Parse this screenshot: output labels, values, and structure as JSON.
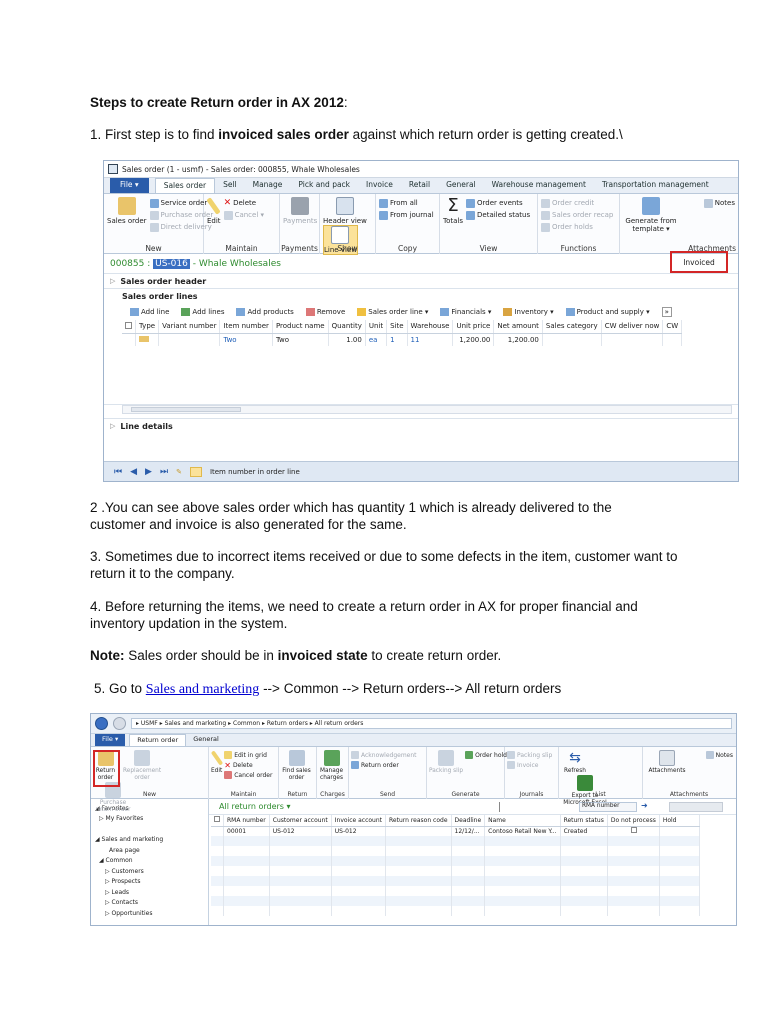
{
  "doc": {
    "heading": "Steps to create Return order in AX 2012",
    "heading_suffix": ":",
    "step1_pre": "1. First step is to find ",
    "step1_bold": "invoiced sales order",
    "step1_post": " against which return order is getting created.\\",
    "step2": "2 .You can see above sales order which has quantity 1 which is already delivered to the customer and invoice is also generated for the same.",
    "step3": "3. Sometimes due to incorrect items received or due to some defects in the item, customer want to return it to the company.",
    "step4": "4. Before returning the items, we need to create a return order in AX for proper financial and inventory updation in the system.",
    "note_label": "Note:",
    "note_pre": " Sales order should be in ",
    "note_bold": "invoiced state",
    "note_post": " to create return order.",
    "step5_pre": "5. Go to ",
    "step5_link": "Sales and marketing",
    "step5_post": " --> Common --> Return orders--> All return orders"
  },
  "shot1": {
    "window_title": "Sales order (1 - usmf) - Sales order: 000855, Whale Wholesales",
    "tabs": [
      "File ▾",
      "Sales order",
      "Sell",
      "Manage",
      "Pick and pack",
      "Invoice",
      "Retail",
      "General",
      "Warehouse management",
      "Transportation management"
    ],
    "groups": {
      "new": {
        "label": "New",
        "big": "Sales order",
        "items": [
          "Service order",
          "Purchase order",
          "Direct delivery"
        ]
      },
      "maintain": {
        "label": "Maintain",
        "big": "Edit",
        "items": [
          "Delete",
          "Cancel ▾"
        ]
      },
      "payments": {
        "label": "Payments",
        "big": "Payments"
      },
      "show": {
        "label": "Show",
        "items": [
          "Header view",
          "Line view"
        ]
      },
      "copy": {
        "label": "Copy",
        "items": [
          "From all",
          "From journal"
        ]
      },
      "view": {
        "label": "View",
        "big": "Totals",
        "items": [
          "Order events",
          "Detailed status"
        ]
      },
      "functions": {
        "label": "Functions",
        "items": [
          "Order credit",
          "Sales order recap",
          "Order holds"
        ]
      },
      "attachments": {
        "label": "Attachments",
        "big": "Generate from template ▾",
        "notes": "Notes"
      }
    },
    "record_id": "000855 : ",
    "record_selected": "US-016",
    "record_name": " - Whale Wholesales",
    "status": "Invoiced",
    "header_fasttab": "Sales order header",
    "lines_title": "Sales order lines",
    "toolbar": [
      "Add line",
      "Add lines",
      "Add products",
      "Remove",
      "Sales order line ▾",
      "Financials ▾",
      "Inventory ▾",
      "Product and supply ▾",
      "»"
    ],
    "columns": [
      "Type",
      "Variant number",
      "Item number",
      "Product name",
      "Quantity",
      "Unit",
      "Site",
      "Warehouse",
      "Unit price",
      "Net amount",
      "Sales category",
      "CW deliver now",
      "CW"
    ],
    "row": [
      "",
      "",
      "Two",
      "Two",
      "1.00",
      "ea",
      "1",
      "11",
      "1,200.00",
      "1,200.00",
      "",
      "",
      ""
    ],
    "line_details": "Line details",
    "status_text": "Item number in order line"
  },
  "shot2": {
    "breadcrumb": "▸ USMF ▸ Sales and marketing ▸ Common ▸ Return orders ▸ All return orders",
    "tabs": [
      "File ▾",
      "Return order",
      "General"
    ],
    "groups": {
      "new": {
        "label": "New",
        "items": [
          "Return order",
          "Replacement order",
          "Purchase return order"
        ]
      },
      "maintain": {
        "label": "Maintain",
        "big": "Edit",
        "items": [
          "Edit in grid",
          "Delete",
          "Cancel order"
        ]
      },
      "return": {
        "label": "Return",
        "big": "Find sales order"
      },
      "charges": {
        "label": "Charges",
        "big": "Manage charges"
      },
      "send": {
        "label": "Send",
        "items": [
          "Acknowledgement",
          "Return order"
        ]
      },
      "generate": {
        "label": "Generate",
        "big": "Packing slip",
        "items": [
          "Order holds"
        ]
      },
      "journals": {
        "label": "Journals",
        "items": [
          "Packing slip",
          "Invoice"
        ]
      },
      "list": {
        "label": "List",
        "items": [
          "Refresh",
          "Export to Microsoft Excel"
        ]
      },
      "attachments": {
        "label": "Attachments",
        "big": "Attachments",
        "notes": "Notes"
      }
    },
    "nav": [
      "◢ Favorites",
      "▷ My Favorites",
      "",
      "◢ Sales and marketing",
      "Area page",
      "◢ Common",
      "▷ Customers",
      "▷ Prospects",
      "▷ Leads",
      "▷ Contacts",
      "▷ Opportunities"
    ],
    "list_title": "All return orders ▾",
    "filter_field": "RMA number",
    "columns": [
      "RMA number",
      "Customer account",
      "Invoice account",
      "Return reason code",
      "Deadline",
      "Name",
      "Return status",
      "Do not process",
      "Hold"
    ],
    "row": [
      "00001",
      "US-012",
      "US-012",
      "",
      "12/12/...",
      "Contoso Retail New Y...",
      "Created",
      "",
      ""
    ]
  }
}
